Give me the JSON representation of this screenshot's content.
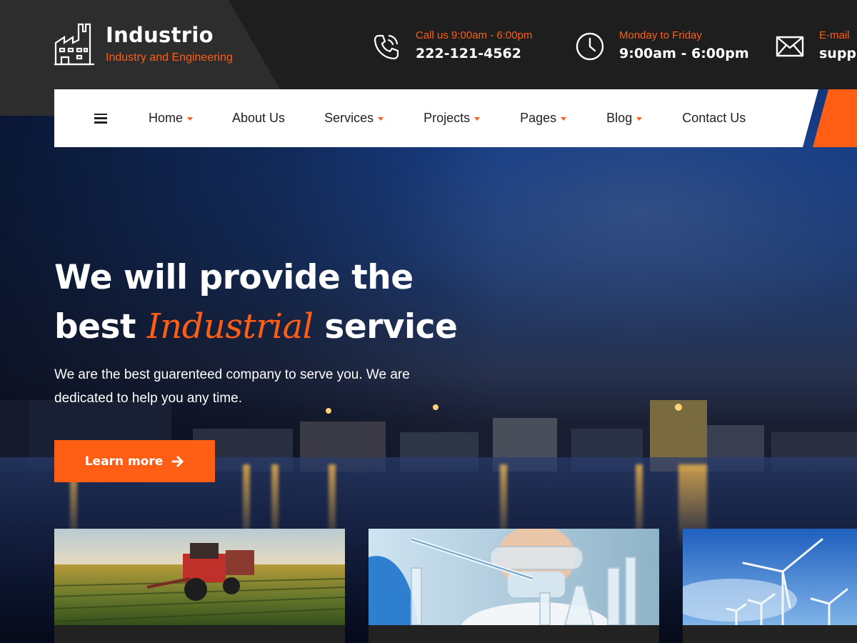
{
  "brand": {
    "name": "Industrio",
    "tagline": "Industry and Engineering"
  },
  "contacts": [
    {
      "icon": "phone-icon",
      "label": "Call us 9:00am - 6:00pm",
      "value": "222-121-4562"
    },
    {
      "icon": "clock-icon",
      "label": "Monday to Friday",
      "value": "9:00am - 6:00pm"
    },
    {
      "icon": "envelope-icon",
      "label": "E-mail",
      "value": "supp"
    }
  ],
  "nav": {
    "items": [
      {
        "label": "Home",
        "has_dropdown": true
      },
      {
        "label": "About Us",
        "has_dropdown": false
      },
      {
        "label": "Services",
        "has_dropdown": true
      },
      {
        "label": "Projects",
        "has_dropdown": true
      },
      {
        "label": "Pages",
        "has_dropdown": true
      },
      {
        "label": "Blog",
        "has_dropdown": true
      },
      {
        "label": "Contact Us",
        "has_dropdown": false
      }
    ]
  },
  "hero": {
    "line1": "We will provide the",
    "line2_before": "best ",
    "line2_accent": "Industrial",
    "line2_after": " service",
    "subtext": "We are the best guarenteed company to serve you. We are dedicated to help you any time.",
    "cta_label": "Learn more"
  },
  "colors": {
    "accent": "#ff5e14",
    "topbar_dark": "#1e1e1e",
    "topbar_logo_bg": "#2d2d2d",
    "nav_bg": "#ffffff"
  },
  "cards": [
    {
      "image": "tractor-field"
    },
    {
      "image": "lab-scientist"
    },
    {
      "image": "wind-turbines"
    }
  ]
}
